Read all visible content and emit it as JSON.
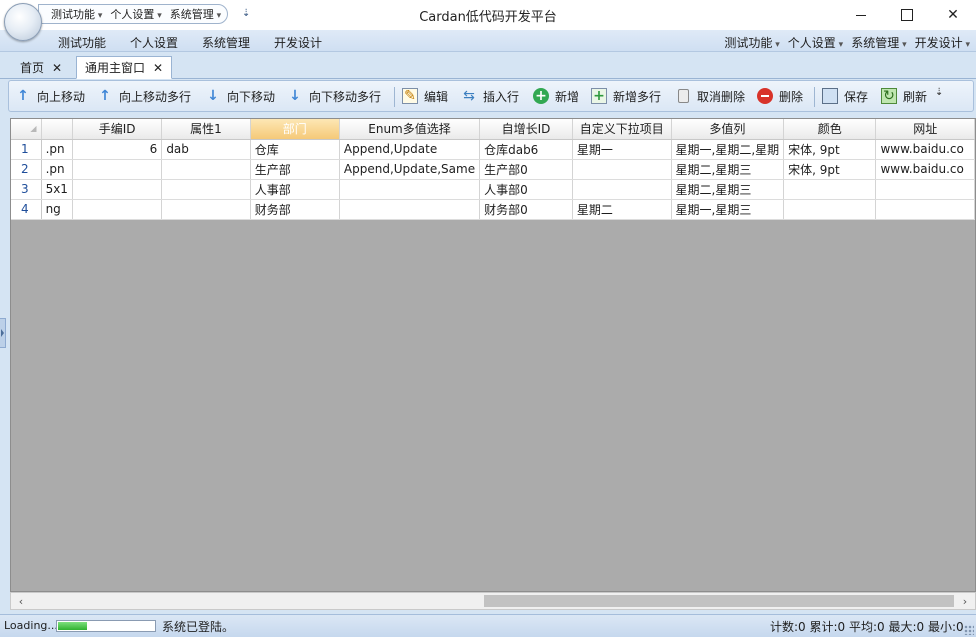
{
  "window": {
    "title": "Cardan低代码开发平台",
    "close_glyph": "✕"
  },
  "quick_access": [
    "测试功能",
    "个人设置",
    "系统管理"
  ],
  "quick_access_more": "⇣",
  "menu": {
    "left": [
      "测试功能",
      "个人设置",
      "系统管理",
      "开发设计"
    ],
    "right": [
      "测试功能",
      "个人设置",
      "系统管理",
      "开发设计"
    ]
  },
  "tabs": [
    {
      "label": "首页",
      "close": "✕"
    },
    {
      "label": "通用主窗口",
      "close": "✕"
    }
  ],
  "toolbar": {
    "move_up": "向上移动",
    "move_up_multi": "向上移动多行",
    "move_down": "向下移动",
    "move_down_multi": "向下移动多行",
    "edit": "编辑",
    "insert_row": "插入行",
    "add": "新增",
    "add_multi": "新增多行",
    "cancel_delete": "取消删除",
    "delete": "删除",
    "save": "保存",
    "refresh": "刷新",
    "more": "⇣",
    "icons": {
      "up": "↑",
      "down": "↓",
      "edit": "✎",
      "insert": "⇆",
      "add": "+",
      "add_multi": "+",
      "refresh": "↻"
    }
  },
  "grid": {
    "columns": [
      "手编ID",
      "属性1",
      "部门",
      "Enum多值选择",
      "自增长ID",
      "自定义下拉项目",
      "多值列",
      "颜色",
      "网址"
    ],
    "sorted_column": "部门",
    "rows": [
      {
        "num": "1",
        "cut": ".pn",
        "cells": [
          "6",
          "dab",
          "仓库",
          "Append,Update",
          "仓库dab6",
          "星期一",
          "星期一,星期二,星期",
          "宋体, 9pt",
          "www.baidu.co"
        ]
      },
      {
        "num": "2",
        "cut": ".pn",
        "cells": [
          "",
          "",
          "生产部",
          "Append,Update,Same",
          "生产部0",
          "",
          "星期二,星期三",
          "宋体, 9pt",
          "www.baidu.co"
        ]
      },
      {
        "num": "3",
        "cut": "5x1",
        "cells": [
          "",
          "",
          "人事部",
          "",
          "人事部0",
          "",
          "星期二,星期三",
          "",
          ""
        ]
      },
      {
        "num": "4",
        "cut": "ng",
        "cells": [
          "",
          "",
          "财务部",
          "",
          "财务部0",
          "星期二",
          "星期一,星期三",
          "",
          ""
        ]
      }
    ]
  },
  "scrollbar": {
    "left": "‹",
    "right": "›"
  },
  "status": {
    "loading": "Loading...",
    "progress_fraction": 0.3,
    "login": "系统已登陆。",
    "stats": "计数:0 累计:0 平均:0 最大:0 最小:0"
  }
}
